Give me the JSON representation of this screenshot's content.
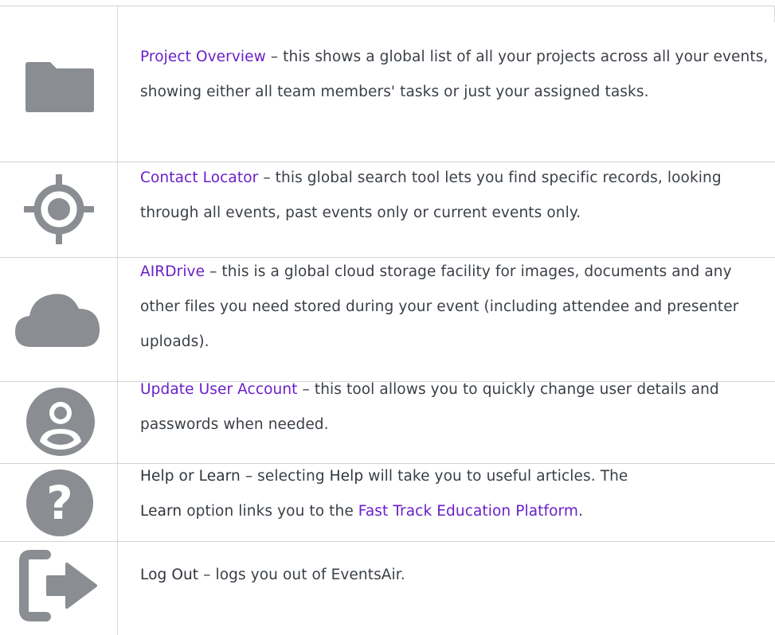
{
  "rows": [
    {
      "icon": "folder-icon",
      "link": "Project Overview",
      "text": " – this shows a global list of all your projects across all your events, showing either all team members' tasks or just your assigned tasks."
    },
    {
      "icon": "target-icon",
      "link": "Contact Locator",
      "text": " – this global search tool lets you find specific records, looking through all events, past events only or current events only."
    },
    {
      "icon": "cloud-icon",
      "link": "AIRDrive",
      "text": " – this is a global cloud storage facility for images, documents and any other files you need stored during your event (including attendee and presenter uploads)."
    },
    {
      "icon": "account-icon",
      "link": "Update User Account",
      "text": " – this tool allows you to quickly change user details and passwords when needed."
    },
    {
      "icon": "help-icon",
      "title": "Help or Learn",
      "text_a": " – selecting ",
      "help_word": "Help",
      "text_b": " will take you to useful articles. The ",
      "learn_word": "Learn",
      "text_c": " option links you to the ",
      "link": "Fast Track Education Platform",
      "text_d": "."
    },
    {
      "icon": "logout-icon",
      "title": "Log Out",
      "text": " – logs you out of EventsAir."
    }
  ],
  "colors": {
    "link": "#6a1fc9",
    "body_text": "#3a3f47",
    "icon": "#8a8d92",
    "divider": "#d3d3d3"
  }
}
